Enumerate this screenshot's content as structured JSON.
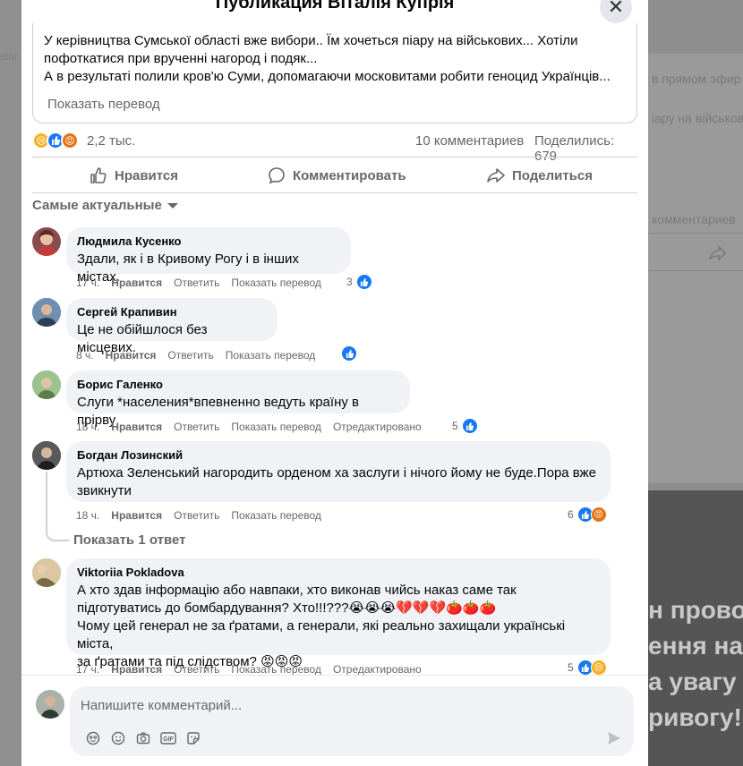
{
  "post": {
    "title": "Публикация Віталія Купрія",
    "text_lines": [
      "У керівництва Сумської області вже вибори.. Їм хочеться піару на військових... Хотіли",
      "пофоткатися при врученні нагород і подяк...",
      "А в результаті полили кров'ю Суми, допомагаючи московитами робити геноцид Українців..."
    ],
    "show_translation": "Показать перевод",
    "reaction_count": "2,2 тыс.",
    "comments_count": "10 комментариев",
    "shares_count": "Поделились: 679"
  },
  "actions": {
    "like": "Нравится",
    "comment": "Комментировать",
    "share": "Поделиться"
  },
  "sort_label": "Самые актуальные",
  "comments": [
    {
      "author": "Людмила Кусенко",
      "lines": [
        "Здали, як і в Кривому Рогу і в інших містах."
      ],
      "time": "17 ч.",
      "like": "Нравится",
      "reply": "Ответить",
      "translate": "Показать перевод",
      "edited": "",
      "reactions": "3"
    },
    {
      "author": "Сергей Крапивин",
      "lines": [
        "Це не обійшлося без місцевих."
      ],
      "time": "8 ч.",
      "like": "Нравится",
      "reply": "Ответить",
      "translate": "Показать перевод",
      "edited": "",
      "reactions": ""
    },
    {
      "author": "Борис Галенко",
      "lines": [
        "Слуги *населения*впевненно ведуть країну в прірву"
      ],
      "time": "18 ч.",
      "like": "Нравится",
      "reply": "Ответить",
      "translate": "Показать перевод",
      "edited": "Отредактировано",
      "reactions": "5"
    },
    {
      "author": "Богдан Лозинский",
      "lines": [
        "Артюха Зеленський нагородить орденом ха заслуги і нічого йому не буде.Пора вже",
        "звикнути"
      ],
      "time": "18 ч.",
      "like": "Нравится",
      "reply": "Ответить",
      "translate": "Показать перевод",
      "edited": "",
      "reactions": "6"
    },
    {
      "author": "Viktoriia Pokladova",
      "lines": [
        "А хто здав інформацію або навпаки, хто виконав чийсь наказ саме так",
        "підготуватись до бомбардування? Хто!!!???😭😭😭💔💔💔🍅🍅🍅",
        "Чому цей генерал не за ґратами, а генерали, які реально захищали українські міста,",
        "за ґратами та під слідством? 😡😡😡"
      ],
      "time": "17 ч.",
      "like": "Нравится",
      "reply": "Ответить",
      "translate": "Показать перевод",
      "edited": "Отредактировано",
      "reactions": "5"
    }
  ],
  "show_replies": "Показать 1 ответ",
  "composer": {
    "placeholder": "Напишите комментарий..."
  },
  "background": {
    "snippets": [
      "в прямом эфир",
      "іару на військов",
      "комментариев",
      "н провод",
      "ення на",
      "а увагу",
      "ривогу!",
      "stor"
    ]
  },
  "colors": {
    "like_blue": "#1877f2",
    "angry_orange": "#e9710f",
    "care_yellow": "#f7b125",
    "text_gray": "#65676b"
  }
}
